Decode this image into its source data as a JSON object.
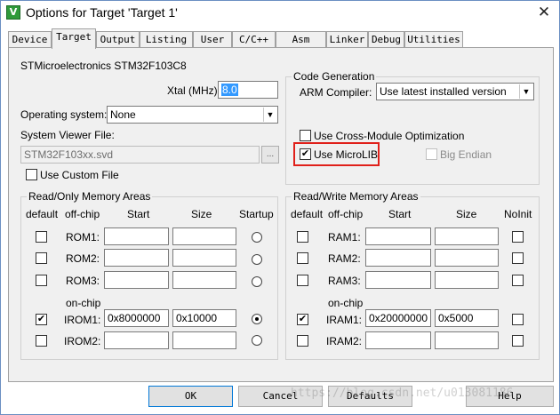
{
  "window": {
    "title": "Options for Target 'Target 1'",
    "close_glyph": "✕",
    "app_icon_glyph": "V"
  },
  "tabs": [
    {
      "label": "Device",
      "active": false
    },
    {
      "label": "Target",
      "active": true
    },
    {
      "label": "Output",
      "active": false
    },
    {
      "label": "Listing",
      "active": false
    },
    {
      "label": "User",
      "active": false
    },
    {
      "label": "C/C++",
      "active": false
    },
    {
      "label": "Asm",
      "active": false
    },
    {
      "label": "Linker",
      "active": false
    },
    {
      "label": "Debug",
      "active": false
    },
    {
      "label": "Utilities",
      "active": false
    }
  ],
  "device": {
    "name": "STMicroelectronics STM32F103C8",
    "xtal_label": "Xtal (MHz):",
    "xtal_value": "8.0",
    "os_label": "Operating system:",
    "os_value": "None",
    "svf_label": "System Viewer File:",
    "svf_value": "STM32F103xx.svd",
    "svf_browse": "...",
    "custom_file_label": "Use Custom File",
    "custom_file_checked": false
  },
  "code_gen": {
    "title": "Code Generation",
    "compiler_label": "ARM Compiler:",
    "compiler_value": "Use latest installed version",
    "cross_module_label": "Use Cross-Module Optimization",
    "cross_module_checked": false,
    "microlib_label": "Use MicroLIB",
    "microlib_checked": true,
    "big_endian_label": "Big Endian",
    "big_endian_checked": false,
    "check_glyph": "✔"
  },
  "rom": {
    "title": "Read/Only Memory Areas",
    "headers": {
      "default": "default",
      "offchip": "off-chip",
      "start": "Start",
      "size": "Size",
      "last": "Startup"
    },
    "onchip_label": "on-chip",
    "rows": [
      {
        "name": "ROM1:",
        "start": "",
        "size": "",
        "default": false,
        "selected": false
      },
      {
        "name": "ROM2:",
        "start": "",
        "size": "",
        "default": false,
        "selected": false
      },
      {
        "name": "ROM3:",
        "start": "",
        "size": "",
        "default": false,
        "selected": false
      },
      {
        "name": "IROM1:",
        "start": "0x8000000",
        "size": "0x10000",
        "default": true,
        "selected": true
      },
      {
        "name": "IROM2:",
        "start": "",
        "size": "",
        "default": false,
        "selected": false
      }
    ]
  },
  "ram": {
    "title": "Read/Write Memory Areas",
    "headers": {
      "default": "default",
      "offchip": "off-chip",
      "start": "Start",
      "size": "Size",
      "last": "NoInit"
    },
    "onchip_label": "on-chip",
    "rows": [
      {
        "name": "RAM1:",
        "start": "",
        "size": "",
        "default": false,
        "noinit": false
      },
      {
        "name": "RAM2:",
        "start": "",
        "size": "",
        "default": false,
        "noinit": false
      },
      {
        "name": "RAM3:",
        "start": "",
        "size": "",
        "default": false,
        "noinit": false
      },
      {
        "name": "IRAM1:",
        "start": "0x20000000",
        "size": "0x5000",
        "default": true,
        "noinit": false
      },
      {
        "name": "IRAM2:",
        "start": "",
        "size": "",
        "default": false,
        "noinit": false
      }
    ]
  },
  "buttons": {
    "ok": "OK",
    "cancel": "Cancel",
    "defaults": "Defaults",
    "help": "Help"
  },
  "watermark": "https://blog.csdn.net/u013081186",
  "colors": {
    "highlight": "#e0201a",
    "accent": "#3399ff"
  }
}
